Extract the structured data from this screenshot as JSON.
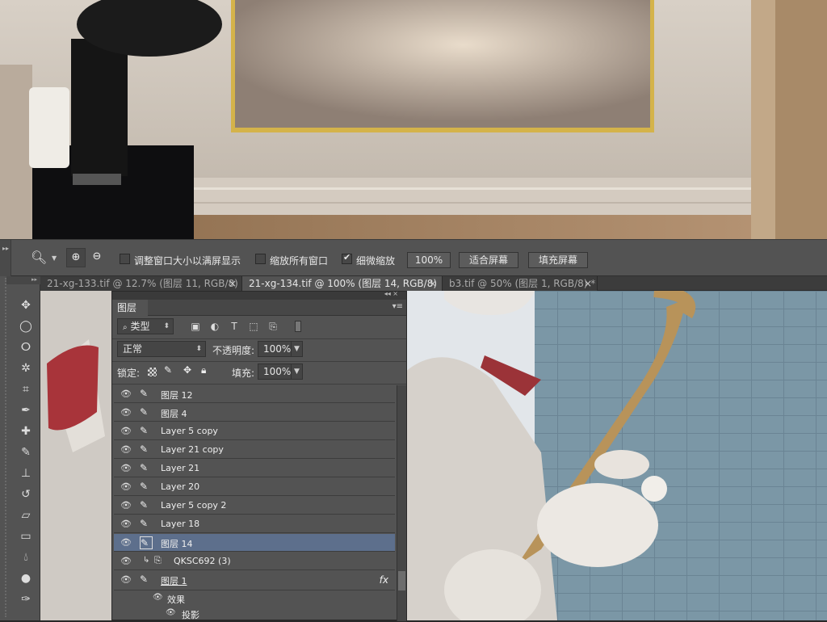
{
  "options_bar": {
    "resize_windows_label": "调整窗口大小以满屏显示",
    "resize_windows_checked": false,
    "zoom_all_windows_label": "缩放所有窗口",
    "zoom_all_windows_checked": false,
    "scrubby_zoom_label": "细微缩放",
    "scrubby_zoom_checked": true,
    "zoom_100_label": "100%",
    "fit_screen_label": "适合屏幕",
    "fill_screen_label": "填充屏幕"
  },
  "document_tabs": [
    {
      "label": "21-xg-133.tif @ 12.7% (图层 11, RGB/8)",
      "close": "×",
      "active": false
    },
    {
      "label": "21-xg-134.tif @ 100% (图层 14, RGB/8)",
      "close": "×",
      "active": true
    },
    {
      "label": "b3.tif @ 50% (图层 1, RGB/8) *",
      "close": "×",
      "active": false
    }
  ],
  "layers_panel": {
    "title": "图层",
    "filter_kind": "类型",
    "blend_mode": "正常",
    "opacity_label": "不透明度:",
    "opacity_value": "100%",
    "lock_label": "锁定:",
    "fill_label": "填充:",
    "fill_value": "100%",
    "layers": [
      {
        "name": "图层 12",
        "selected": false
      },
      {
        "name": "图层 4",
        "selected": false
      },
      {
        "name": "Layer 5 copy",
        "selected": false
      },
      {
        "name": "Layer 21 copy",
        "selected": false
      },
      {
        "name": "Layer 21",
        "selected": false
      },
      {
        "name": "Layer 20",
        "selected": false
      },
      {
        "name": "Layer 5 copy 2",
        "selected": false
      },
      {
        "name": "Layer 18",
        "selected": false
      },
      {
        "name": "图层 14",
        "selected": true
      }
    ],
    "smart_object_name": "QKSC692 (3)",
    "layer_1_name": "图层 1",
    "fx_badge": "fx",
    "effects_label": "效果",
    "drop_shadow_label": "投影"
  },
  "colors": {
    "panel_bg": "#535353",
    "selected_row": "#5d6f8c",
    "frame_gold": "#d4b34a",
    "wall_blue": "#7a96a5",
    "sax_gold": "#b8935a"
  }
}
